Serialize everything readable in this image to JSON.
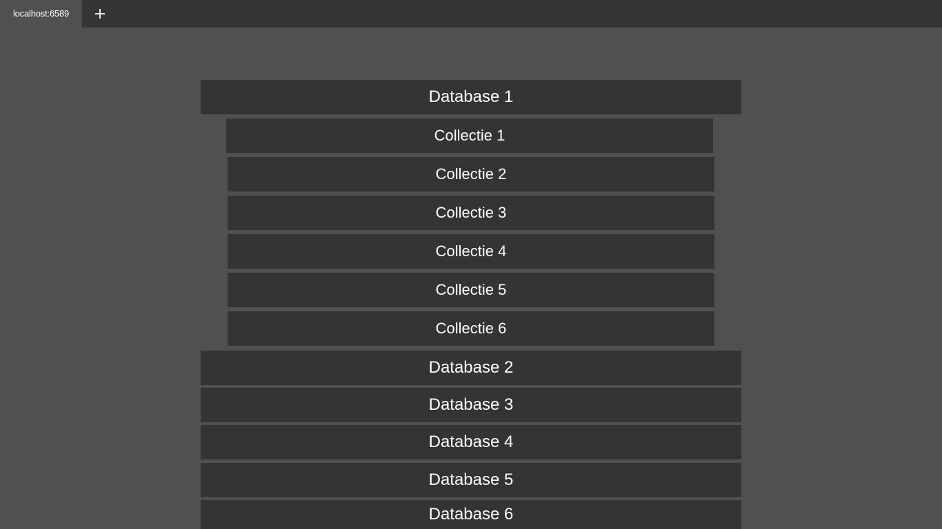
{
  "browser": {
    "tab_title": "localhost:6589",
    "new_tab_icon": "plus-icon"
  },
  "databases": [
    {
      "label": "Database 1",
      "collections": [
        {
          "label": "Collectie 1"
        },
        {
          "label": "Collectie 2"
        },
        {
          "label": "Collectie 3"
        },
        {
          "label": "Collectie 4"
        },
        {
          "label": "Collectie 5"
        },
        {
          "label": "Collectie 6"
        }
      ]
    },
    {
      "label": "Database 2"
    },
    {
      "label": "Database 3"
    },
    {
      "label": "Database 4"
    },
    {
      "label": "Database 5"
    },
    {
      "label": "Database 6"
    }
  ],
  "colors": {
    "page_background": "#505050",
    "tabbar_background": "#353535",
    "item_background": "#343434",
    "text": "#ffffff"
  }
}
